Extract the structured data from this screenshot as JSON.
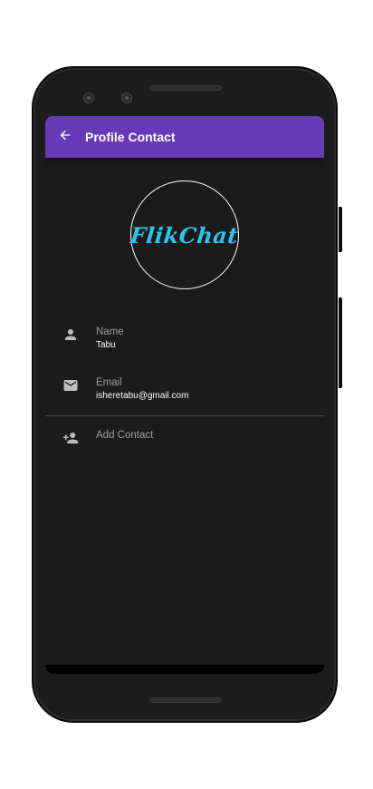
{
  "app_bar": {
    "title": "Profile Contact",
    "color": "#673ab7",
    "back_icon": "arrow-back-icon"
  },
  "avatar": {
    "logo_text": "FlikChat",
    "logo_color": "#29c6f0"
  },
  "contact": {
    "name": {
      "icon": "person-icon",
      "label": "Name",
      "value": "Tabu"
    },
    "email": {
      "icon": "mail-icon",
      "label": "Email",
      "value": "isheretabu@gmail.com"
    }
  },
  "actions": {
    "add_contact": {
      "icon": "person-add-icon",
      "label": "Add Contact"
    }
  }
}
